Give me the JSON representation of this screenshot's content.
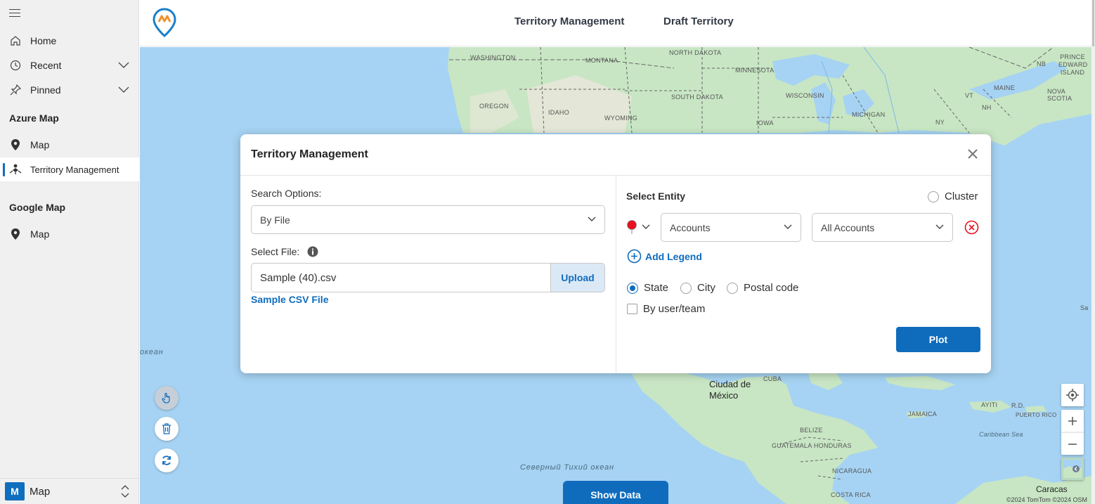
{
  "sidebar": {
    "items": [
      {
        "label": "Home",
        "icon": "home-icon"
      },
      {
        "label": "Recent",
        "icon": "clock-icon"
      },
      {
        "label": "Pinned",
        "icon": "pin-icon"
      }
    ],
    "sections": [
      {
        "title": "Azure Map",
        "items": [
          {
            "label": "Map",
            "icon": "map-pin-icon"
          },
          {
            "label": "Territory Management",
            "icon": "territory-icon",
            "active": true
          }
        ]
      },
      {
        "title": "Google Map",
        "items": [
          {
            "label": "Map",
            "icon": "map-pin-icon"
          }
        ]
      }
    ],
    "app_switcher": {
      "badge": "M",
      "label": "Map"
    }
  },
  "header": {
    "nav": [
      "Territory Management",
      "Draft Territory"
    ]
  },
  "map": {
    "labels": [
      "WASHINGTON",
      "MONTANA",
      "NORTH DAKOTA",
      "MINNESOTA",
      "OREGON",
      "IDAHO",
      "WYOMING",
      "SOUTH DAKOTA",
      "WISCONSIN",
      "MICHIGAN",
      "IOWA",
      "NY",
      "VT",
      "NH",
      "MAINE",
      "NB",
      "PRINCE EDWARD ISLAND",
      "NOVA SCOTIA",
      "CUBA",
      "JAMAICA",
      "AYITI",
      "R.D.",
      "PUERTO RICO",
      "BELIZE",
      "GUATEMALA HONDURAS",
      "NICARAGUA",
      "COSTA RICA",
      "Caracas",
      "Sa"
    ],
    "ocean_labels": [
      "океан",
      "Северный Тихий океан",
      "Caribbean Sea"
    ],
    "city_label": "Ciudad de México",
    "show_data_label": "Show Data",
    "copyright": "©2024 TomTom ©2024 OSM"
  },
  "modal": {
    "title": "Territory Management",
    "search_options_label": "Search Options:",
    "search_option_value": "By File",
    "select_file_label": "Select File:",
    "file_name": "Sample (40).csv",
    "upload_label": "Upload",
    "sample_link": "Sample CSV File",
    "select_entity_label": "Select Entity",
    "cluster_label": "Cluster",
    "entity_value": "Accounts",
    "view_value": "All Accounts",
    "add_legend_label": "Add Legend",
    "radio_options": [
      "State",
      "City",
      "Postal code"
    ],
    "selected_radio": "State",
    "by_user_team_label": "By user/team",
    "plot_label": "Plot"
  },
  "colors": {
    "accent": "#0f6cbd",
    "land": "#c8e6c4",
    "water": "#a6d3f3",
    "pin": "#e81123"
  }
}
